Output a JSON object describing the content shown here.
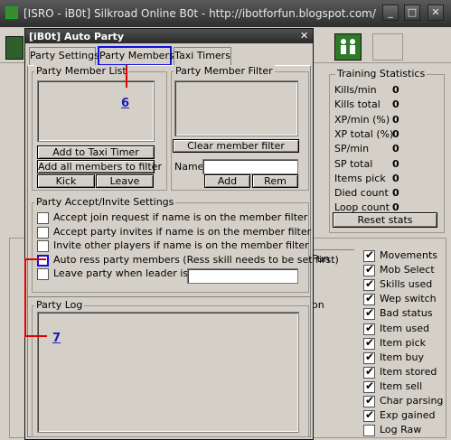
{
  "window": {
    "title": "[ISRO - iB0t] Silkroad Online B0t - http://ibotforfun.blogspot.com/"
  },
  "dialog": {
    "title": "[iB0t] Auto Party",
    "tabs": [
      "Party Settings",
      "Party Members",
      "Taxi Timers"
    ],
    "member_list": {
      "title": "Party Member List"
    },
    "buttons": {
      "add_taxi": "Add to Taxi Timer",
      "add_all": "Add all members to filter",
      "kick": "Kick",
      "leave": "Leave",
      "clear_filter": "Clear member filter",
      "add": "Add",
      "rem": "Rem"
    },
    "filter": {
      "title": "Party Member Filter",
      "name_label": "Name",
      "name_value": ""
    },
    "accept": {
      "title": "Party Accept/Invite Settings",
      "options": [
        "Accept join request if name is on the member filter",
        "Accept party invites if name is on the member filter",
        "Invite other players if name is on the member filter",
        "Auto ress party members (Ress skill needs to be set first)",
        "Leave party when leader is not"
      ],
      "leader_value": ""
    },
    "log": {
      "title": "Party Log"
    }
  },
  "annotations": {
    "six": "6",
    "seven": "7"
  },
  "training": {
    "title": "Training Statistics",
    "rows": [
      {
        "label": "Kills/min",
        "value": "0"
      },
      {
        "label": "Kills total",
        "value": "0"
      },
      {
        "label": "XP/min (%)",
        "value": "0"
      },
      {
        "label": "XP total (%)",
        "value": "0"
      },
      {
        "label": "SP/min",
        "value": "0"
      },
      {
        "label": "SP total",
        "value": "0"
      },
      {
        "label": "Items pick",
        "value": "0"
      },
      {
        "label": "Died count",
        "value": "0"
      },
      {
        "label": "Loop count",
        "value": "0"
      }
    ],
    "reset": "Reset stats"
  },
  "log_options": [
    {
      "label": "Movements",
      "checked": true
    },
    {
      "label": "Mob Select",
      "checked": true
    },
    {
      "label": "Skills used",
      "checked": true
    },
    {
      "label": "Wep switch",
      "checked": true
    },
    {
      "label": "Bad status",
      "checked": true
    },
    {
      "label": "Item used",
      "checked": true
    },
    {
      "label": "Item pick",
      "checked": true
    },
    {
      "label": "Item buy",
      "checked": true
    },
    {
      "label": "Item stored",
      "checked": true
    },
    {
      "label": "Item sell",
      "checked": true
    },
    {
      "label": "Char parsing",
      "checked": true
    },
    {
      "label": "Exp gained",
      "checked": true
    },
    {
      "label": "Log Raw",
      "checked": false
    }
  ],
  "behind": {
    "fun": "Fun",
    "on": "on"
  },
  "colors": {
    "highlight": "#1010e0",
    "annotation_line": "#e00000"
  }
}
